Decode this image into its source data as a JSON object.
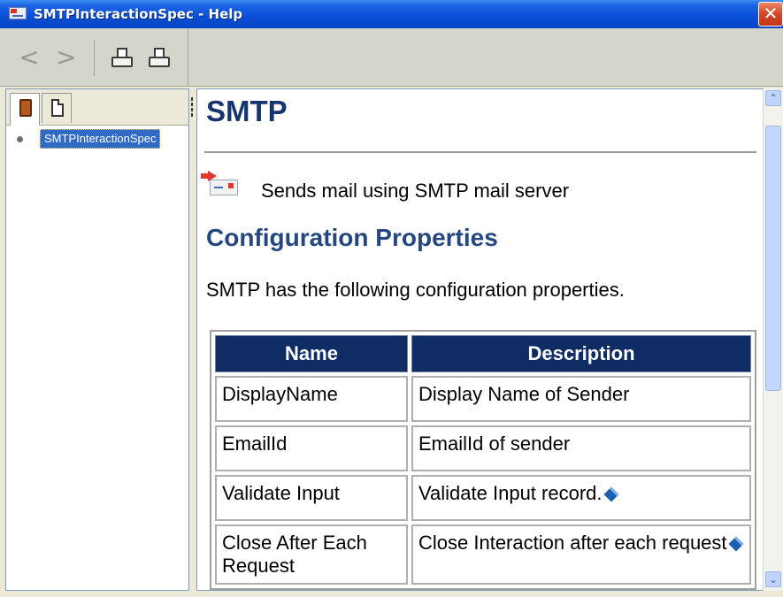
{
  "window": {
    "title": "SMTPInteractionSpec - Help",
    "close_glyph": "✕"
  },
  "toolbar": {
    "back_glyph": "<",
    "forward_glyph": ">"
  },
  "nav": {
    "selected_item": "SMTPInteractionSpec"
  },
  "content": {
    "heading": "SMTP",
    "description": "Sends mail using SMTP mail server",
    "section_heading": "Configuration Properties",
    "intro": "SMTP has the following configuration properties.",
    "table": {
      "headers": [
        "Name",
        "Description"
      ],
      "rows": [
        [
          "DisplayName",
          "Display Name of Sender"
        ],
        [
          "EmailId",
          "EmailId of sender"
        ],
        [
          "Validate Input",
          "Validate Input record."
        ],
        [
          "Close After Each Request",
          "Close Interaction after each request"
        ]
      ]
    }
  },
  "scrollbar": {
    "up_glyph": "⌃",
    "down_glyph": "⌄"
  },
  "icons": [
    "app-icon",
    "back-icon",
    "forward-icon",
    "print-icon",
    "print-preview-icon",
    "book-icon",
    "page-icon",
    "mail-icon",
    "gem-icon",
    "close-icon"
  ],
  "colors": {
    "titlebar": "#0a4fd6",
    "heading": "#16356e",
    "table_header": "#0f2d64",
    "selection": "#316ac5"
  }
}
